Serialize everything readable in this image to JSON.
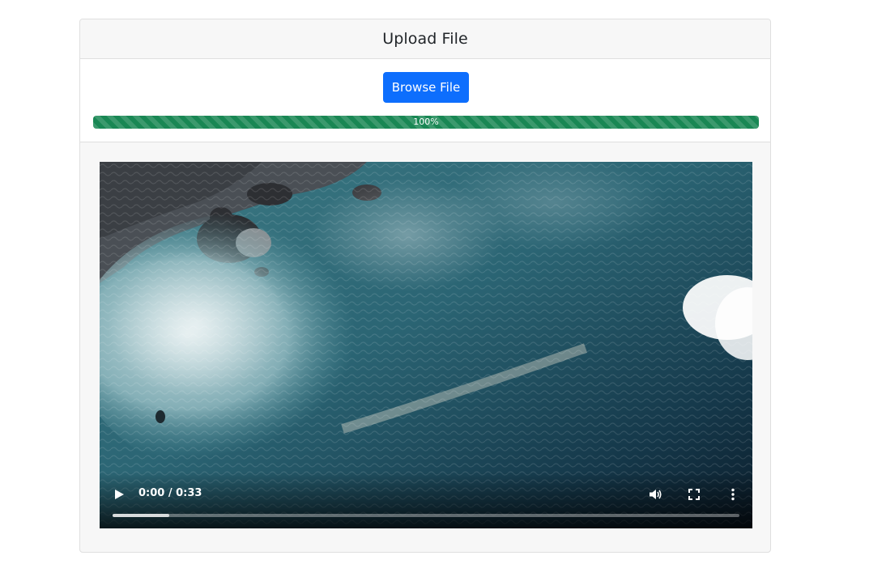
{
  "card": {
    "title": "Upload File"
  },
  "upload": {
    "browse_label": "Browse File",
    "progress_value": 100,
    "progress_label": "100%"
  },
  "video": {
    "time_display": "0:00 / 0:33",
    "buffered_fraction": 0.09,
    "icons": {
      "play": "play-icon",
      "volume": "volume-icon",
      "fullscreen": "fullscreen-icon",
      "more": "more-options-icon"
    }
  },
  "colors": {
    "primary": "#0d6efd",
    "success": "#198754"
  }
}
